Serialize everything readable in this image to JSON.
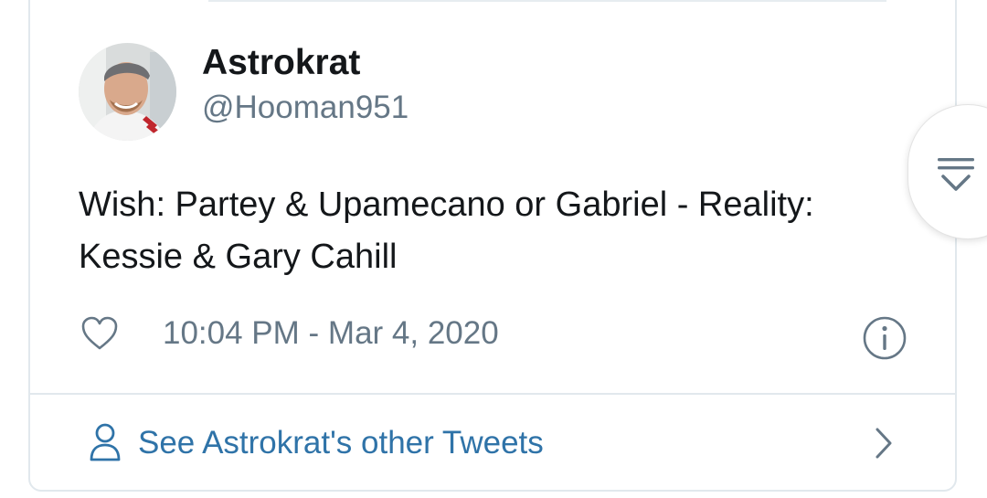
{
  "tweet": {
    "display_name": "Astrokrat",
    "handle": "@Hooman951",
    "text_lines": [
      "Wish: Partey & Upamecano or Gabriel - Reality:",
      "Kessie & Gary Cahill"
    ],
    "timestamp": "10:04 PM - Mar 4, 2020"
  },
  "footer": {
    "other_tweets_label": "See Astrokrat's other Tweets"
  },
  "icons": {
    "like": "heart-outline-icon",
    "info": "info-circle-icon",
    "person": "person-icon",
    "chevron": "chevron-right-icon",
    "filter": "collapse-filter-icon"
  },
  "colors": {
    "text_primary": "#14171a",
    "text_secondary": "#657786",
    "link": "#2f73a8",
    "border": "#e1e8ed"
  }
}
